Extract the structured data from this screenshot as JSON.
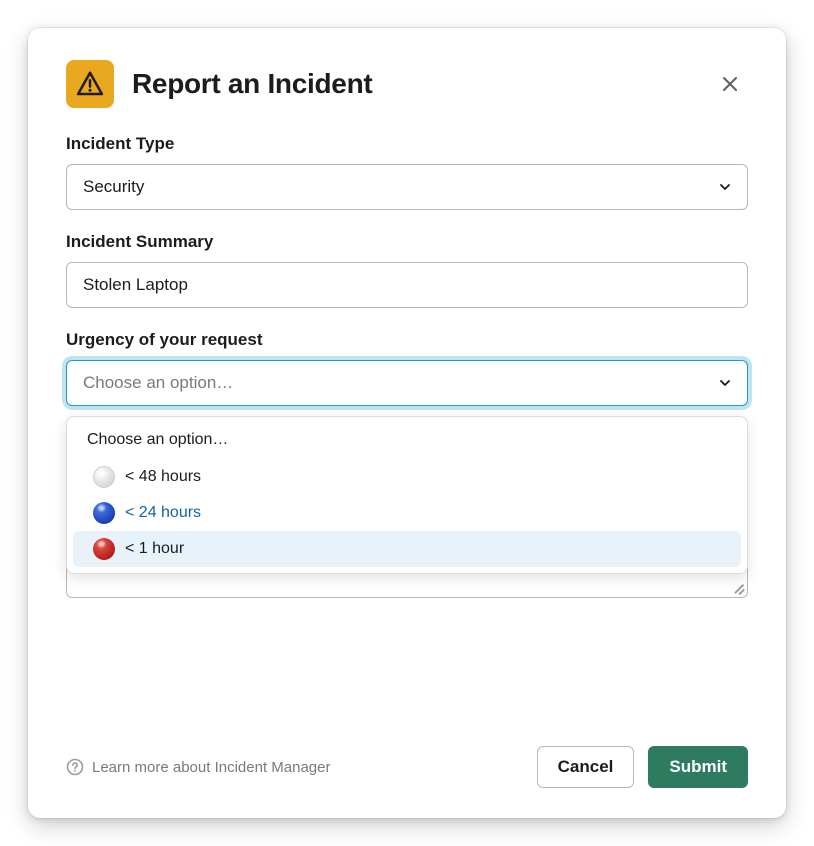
{
  "header": {
    "title": "Report an Incident"
  },
  "incident_type": {
    "label": "Incident Type",
    "value": "Security"
  },
  "incident_summary": {
    "label": "Incident Summary",
    "value": "Stolen Laptop"
  },
  "urgency": {
    "label": "Urgency of your request",
    "placeholder": "Choose an option…",
    "dropdown_header": "Choose an option…",
    "options": [
      {
        "label": "< 48 hours",
        "color": "white"
      },
      {
        "label": "< 24 hours",
        "color": "blue"
      },
      {
        "label": "< 1 hour",
        "color": "red"
      }
    ]
  },
  "footer": {
    "help_text": "Learn more about Incident Manager",
    "cancel": "Cancel",
    "submit": "Submit"
  }
}
